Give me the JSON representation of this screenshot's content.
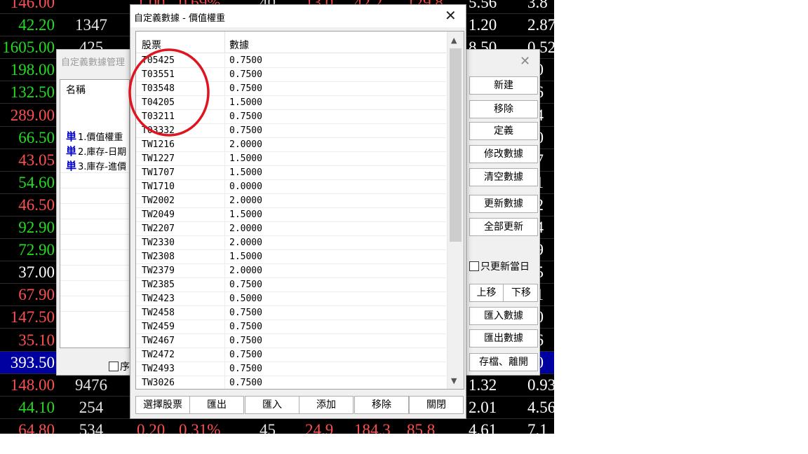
{
  "colors": {
    "up": "#ff5050",
    "down": "#22dd22",
    "flat": "#ffffff",
    "highlight_bg": "#0000a0",
    "annotation": "#e0141e"
  },
  "board": {
    "rows": [
      {
        "left": "146.00",
        "left_color": "up",
        "c1": "",
        "r1": "5.56",
        "r2": "3.8",
        "r1_color": "flat",
        "r2_color": "flat"
      },
      {
        "left": "42.20",
        "left_color": "down",
        "c1": "1347",
        "r1": "1.20",
        "r2": "2.87",
        "r1_color": "flat",
        "r2_color": "flat"
      },
      {
        "left": "1605.00",
        "left_color": "down",
        "c1": "425",
        "r1": "8.50",
        "r2": "0.52",
        "r1_color": "flat",
        "r2_color": "flat"
      },
      {
        "left": "198.00",
        "left_color": "down",
        "c1": "",
        "r1": "",
        "r2": "00",
        "r1_color": "flat",
        "r2_color": "flat"
      },
      {
        "left": "132.50",
        "left_color": "down",
        "c1": "",
        "r1": "",
        "r2": "56",
        "r1_color": "flat",
        "r2_color": "flat"
      },
      {
        "left": "289.00",
        "left_color": "up",
        "c1": "",
        "r1": "",
        "r2": "64",
        "r1_color": "flat",
        "r2_color": "flat"
      },
      {
        "left": "66.50",
        "left_color": "down",
        "c1": "",
        "r1": "",
        "r2": "20",
        "r1_color": "flat",
        "r2_color": "flat"
      },
      {
        "left": "43.05",
        "left_color": "up",
        "c1": "",
        "r1": "",
        "r2": "77",
        "r1_color": "flat",
        "r2_color": "flat"
      },
      {
        "left": "54.60",
        "left_color": "down",
        "c1": "",
        "r1": "",
        "r2": "31",
        "r1_color": "flat",
        "r2_color": "flat"
      },
      {
        "left": "46.50",
        "left_color": "up",
        "c1": "",
        "r1": "",
        "r2": "32",
        "r1_color": "flat",
        "r2_color": "flat"
      },
      {
        "left": "92.90",
        "left_color": "down",
        "c1": "",
        "r1": "",
        "r2": "14",
        "r1_color": "flat",
        "r2_color": "flat"
      },
      {
        "left": "72.90",
        "left_color": "down",
        "c1": "",
        "r1": "",
        "r2": "59",
        "r1_color": "flat",
        "r2_color": "flat"
      },
      {
        "left": "37.00",
        "left_color": "flat",
        "c1": "",
        "r1": "",
        "r2": "25",
        "r1_color": "flat",
        "r2_color": "flat"
      },
      {
        "left": "67.90",
        "left_color": "up",
        "c1": "",
        "r1": "",
        "r2": "91",
        "r1_color": "flat",
        "r2_color": "flat"
      },
      {
        "left": "147.50",
        "left_color": "up",
        "c1": "",
        "r1": "",
        "r2": "60",
        "r1_color": "flat",
        "r2_color": "flat"
      },
      {
        "left": "35.10",
        "left_color": "up",
        "c1": "",
        "r1": "",
        "r2": "46",
        "r1_color": "flat",
        "r2_color": "flat"
      },
      {
        "left": "393.50",
        "left_color": "highlight",
        "c1": "",
        "r1": "",
        "r2": "60",
        "r1_color": "flat",
        "r2_color": "highlight"
      },
      {
        "left": "148.00",
        "left_color": "up",
        "c1": "9476",
        "r1": "1.32",
        "r2": "0.93",
        "r1_color": "flat",
        "r2_color": "flat"
      },
      {
        "left": "44.10",
        "left_color": "down",
        "c1": "254",
        "r1": "2.01",
        "r2": "4.56",
        "r1_color": "flat",
        "r2_color": "flat"
      },
      {
        "left": "64.80",
        "left_color": "up",
        "c1": "534",
        "r1": "4.61",
        "r2": "7.1",
        "r1_color": "flat",
        "r2_color": "flat"
      }
    ],
    "partial_top": [
      "1.00",
      "0.69%",
      "40",
      "13.0",
      "42.2",
      "129.8"
    ],
    "partial_bottom": [
      "0.20",
      "0.31%",
      "45",
      "24.9",
      "184.3",
      "85.8"
    ]
  },
  "manager": {
    "title": "自定義數據管理",
    "list_header": "名稱",
    "items": [
      {
        "icon": "単",
        "label": "1.價值權重"
      },
      {
        "icon": "単",
        "label": "2.庫存-日期"
      },
      {
        "icon": "単",
        "label": "3.庫存-進價"
      }
    ],
    "checkbox_label": "序",
    "buttons": [
      "新建",
      "移除",
      "定義",
      "修改數據",
      "清空數據",
      "更新數據",
      "全部更新"
    ],
    "only_today_label": "只更新當日",
    "move_up": "上移",
    "move_down": "下移",
    "import_label": "匯入數據",
    "export_label": "匯出數據",
    "save_exit_label": "存檔、離開"
  },
  "dialog": {
    "title": "自定義數據 - 價值權重",
    "columns": [
      "股票",
      "數據"
    ],
    "rows": [
      [
        "T05425",
        "0.7500"
      ],
      [
        "T03551",
        "0.7500"
      ],
      [
        "T03548",
        "0.7500"
      ],
      [
        "T04205",
        "1.5000"
      ],
      [
        "T03211",
        "0.7500"
      ],
      [
        "T03332",
        "0.7500"
      ],
      [
        "TW1216",
        "2.0000"
      ],
      [
        "TW1227",
        "1.5000"
      ],
      [
        "TW1707",
        "1.5000"
      ],
      [
        "TW1710",
        "0.0000"
      ],
      [
        "TW2002",
        "2.0000"
      ],
      [
        "TW2049",
        "1.5000"
      ],
      [
        "TW2207",
        "2.0000"
      ],
      [
        "TW2330",
        "2.0000"
      ],
      [
        "TW2308",
        "1.5000"
      ],
      [
        "TW2379",
        "2.0000"
      ],
      [
        "TW2385",
        "0.7500"
      ],
      [
        "TW2423",
        "0.5000"
      ],
      [
        "TW2458",
        "0.7500"
      ],
      [
        "TW2459",
        "0.7500"
      ],
      [
        "TW2467",
        "0.7500"
      ],
      [
        "TW2472",
        "0.7500"
      ],
      [
        "TW2493",
        "0.7500"
      ],
      [
        "TW3026",
        "0.7500"
      ]
    ],
    "buttons": [
      "選擇股票",
      "匯出",
      "匯入",
      "添加",
      "移除",
      "關閉"
    ]
  }
}
